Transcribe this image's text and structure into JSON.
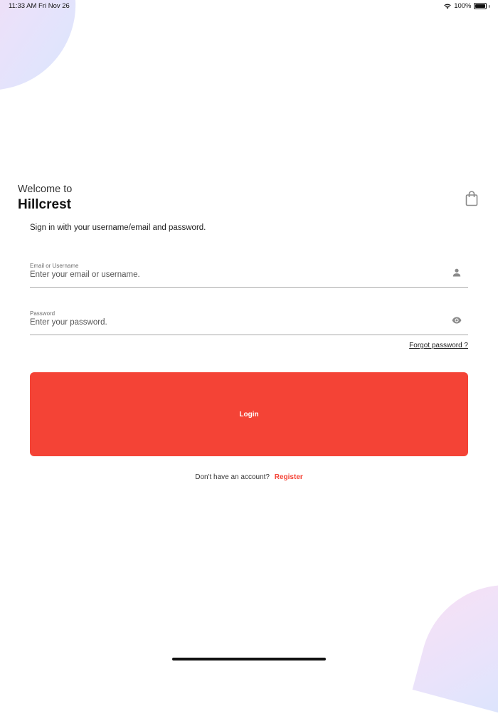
{
  "status_bar": {
    "time": "11:33 AM",
    "date": "Fri Nov 26",
    "battery": "100%"
  },
  "header": {
    "welcome": "Welcome to",
    "brand": "Hillcrest",
    "cart_icon": "shopping-bag-icon"
  },
  "subtitle": "Sign in with your username/email and password.",
  "form": {
    "email": {
      "label": "Email or Username",
      "placeholder": "Enter your email or username.",
      "value": "",
      "icon": "person-icon"
    },
    "password": {
      "label": "Password",
      "placeholder": "Enter your password.",
      "value": "",
      "icon": "eye-icon"
    },
    "forgot_label": "Forgot password ?",
    "login_label": "Login"
  },
  "register": {
    "prompt": "Don't have an account?",
    "link_label": "Register"
  },
  "colors": {
    "accent": "#f44336",
    "underline": "#a9a9a9",
    "icon": "#8a8a8a"
  }
}
